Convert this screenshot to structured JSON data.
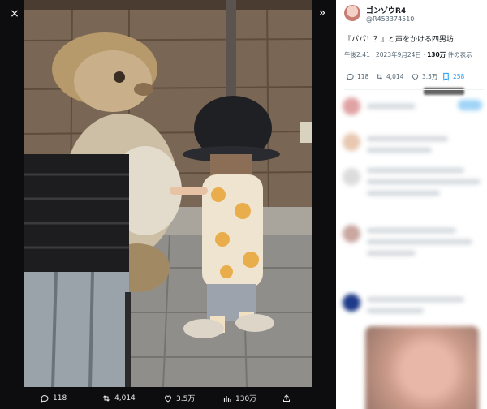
{
  "viewer": {
    "close_icon": "×",
    "expand_icon": "»"
  },
  "media_actions": {
    "reply": "118",
    "retweet": "4,014",
    "like": "3.5万",
    "views": "130万"
  },
  "tweet": {
    "author_name": "ゴンゾウR4",
    "author_handle": "@R453374510",
    "text": "『パパ！？』と声をかける四男坊",
    "time": "午後2:41 · 2023年9月24日 · ",
    "views_count": "130万",
    "views_suffix": " 件の表示"
  },
  "tweet_stats": {
    "reply": "118",
    "retweet": "4,014",
    "like": "3.5万",
    "bookmark": "258"
  },
  "colors": {
    "accent": "#1d9bf0",
    "viewer_bg": "#0d0d0f",
    "panel_bg": "#ffffff"
  }
}
